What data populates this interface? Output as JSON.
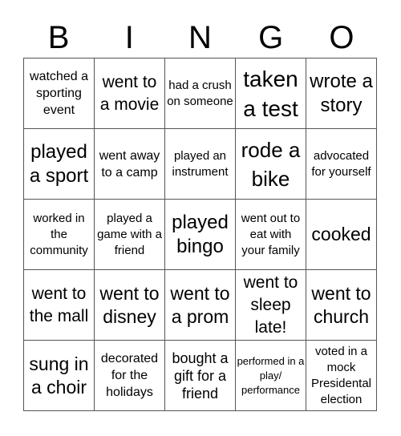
{
  "header": {
    "letters": [
      "B",
      "I",
      "N",
      "G",
      "O"
    ]
  },
  "cells": [
    [
      "watched a sporting event",
      "went to a movie",
      "had a crush on someone",
      "taken a test",
      "wrote a story"
    ],
    [
      "played a sport",
      "went away to a camp",
      "played an instrument",
      "rode a bike",
      "advocated for yourself"
    ],
    [
      "worked in the community",
      "played a game with a friend",
      "played bingo",
      "went out to eat with your family",
      "cooked"
    ],
    [
      "went to the mall",
      "went to disney",
      "went to a prom",
      "went to sleep late!",
      "went to church"
    ],
    [
      "sung in a choir",
      "decorated for the holidays",
      "bought a gift for a friend",
      "performed in a play/ performance",
      "voted in a mock Presidental election"
    ]
  ]
}
